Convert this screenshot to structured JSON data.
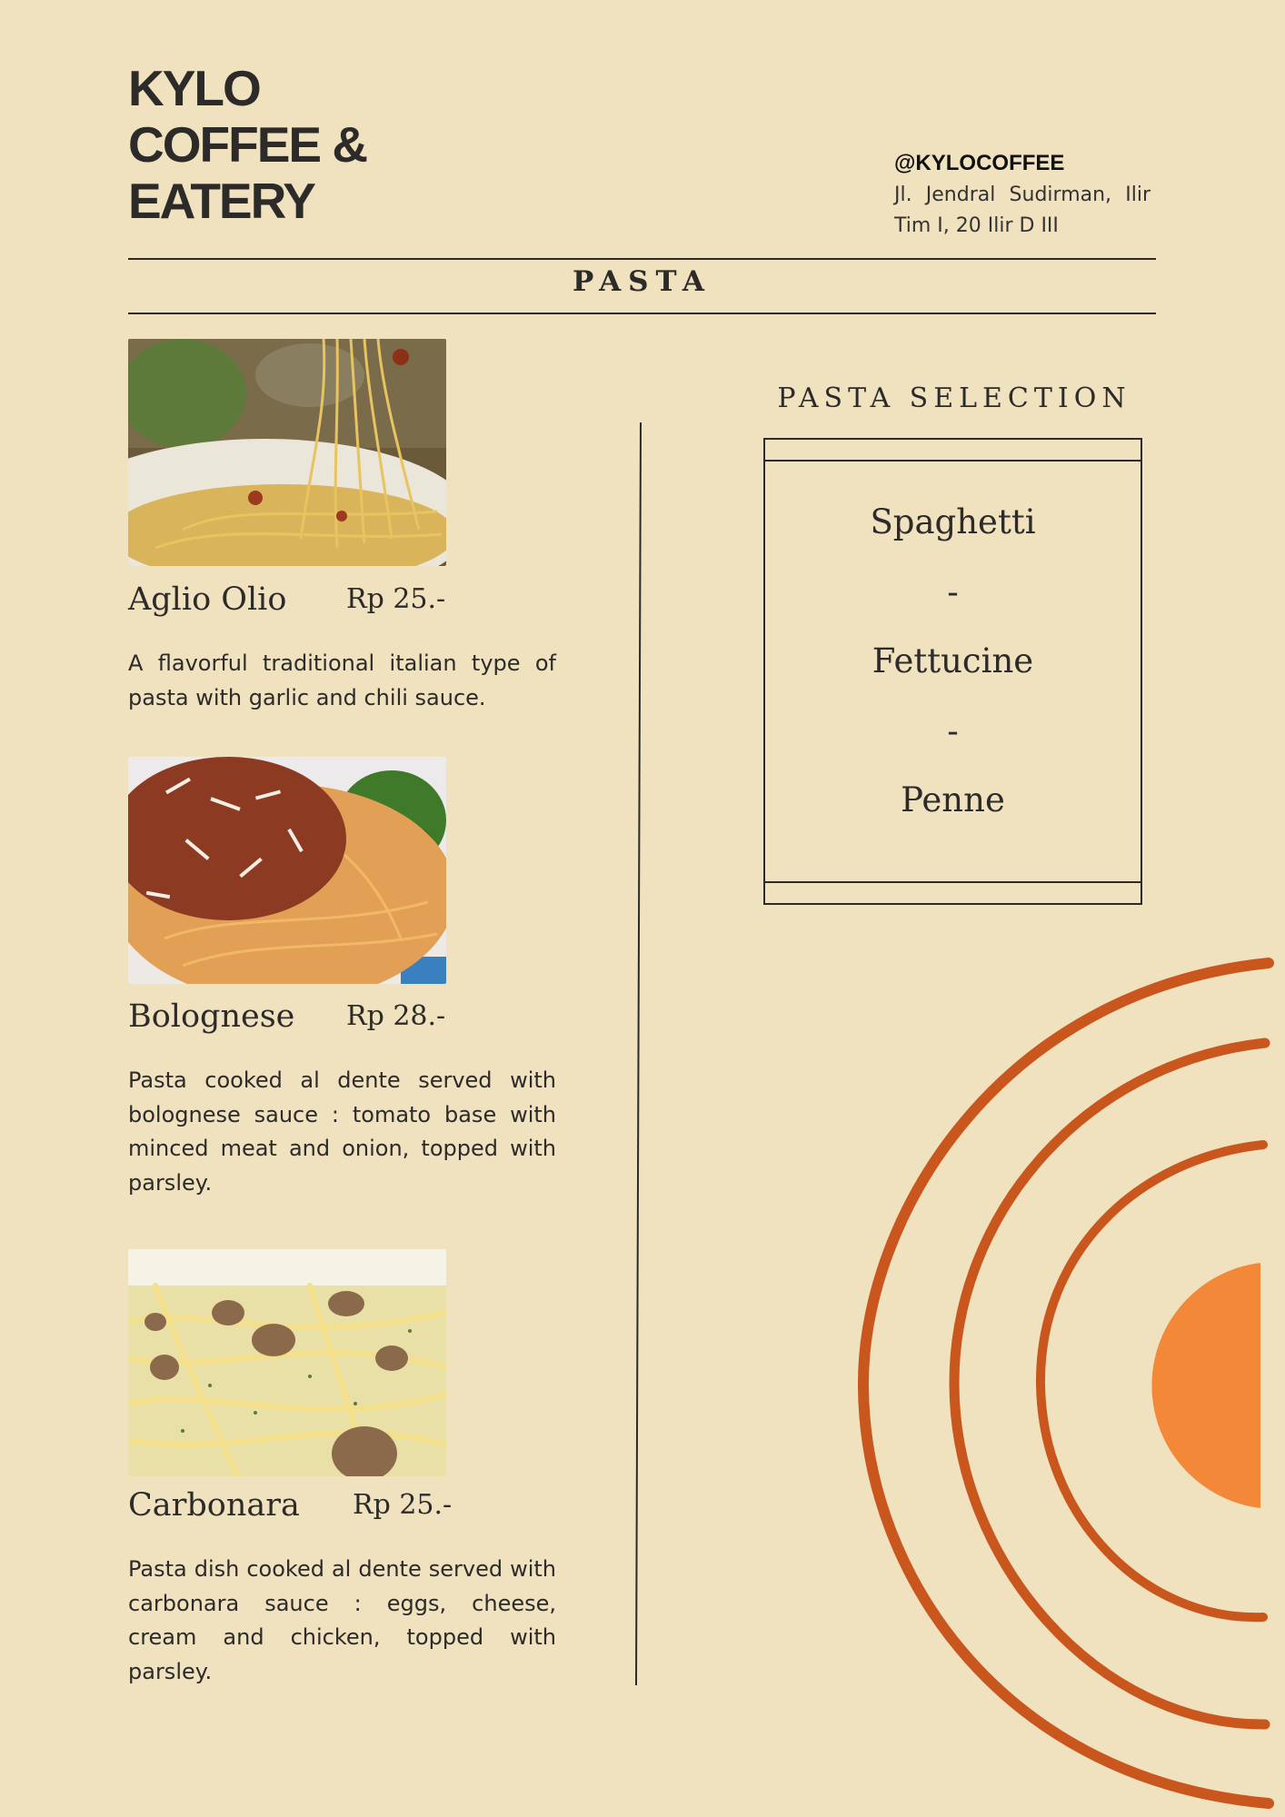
{
  "header": {
    "brand_lines": [
      "KYLO",
      "COFFEE &",
      "EATERY"
    ],
    "handle": "@KYLOCOFFEE",
    "address": "Jl. Jendral Sudirman, Ilir Tim I, 20 Ilir D III"
  },
  "section_title": "PASTA",
  "items": [
    {
      "name": "Aglio Olio",
      "price": "Rp 25.-",
      "description": "A flavorful traditional italian type of pasta with garlic and chili sauce."
    },
    {
      "name": "Bolognese",
      "price": "Rp 28.-",
      "description": "Pasta cooked al dente served with bolognese sauce : tomato base with minced meat and onion, topped with parsley."
    },
    {
      "name": "Carbonara",
      "price": "Rp 25.-",
      "description": "Pasta dish cooked al dente served with carbonara sauce : eggs, cheese, cream and chicken, topped with parsley."
    }
  ],
  "selection": {
    "title": "PASTA SELECTION",
    "options": [
      "Spaghetti",
      "-",
      "Fettucine",
      "-",
      "Penne"
    ]
  },
  "colors": {
    "background": "#f0e1bf",
    "text": "#2c2b29",
    "arc_dark_orange": "#c9561d",
    "semicircle_orange": "#f28838"
  }
}
